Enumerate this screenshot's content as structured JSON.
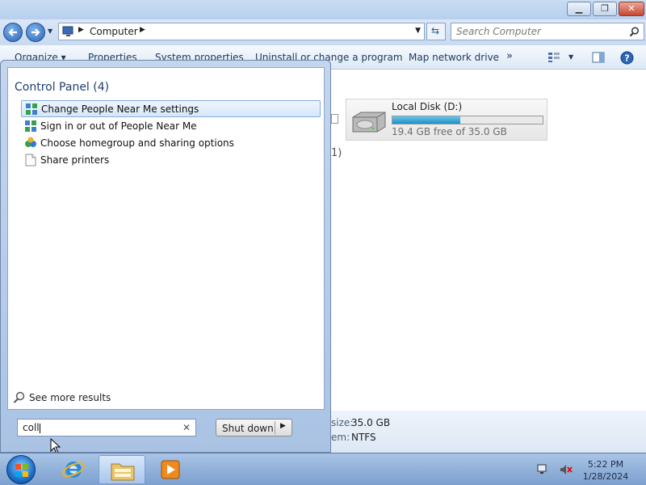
{
  "explorer": {
    "address_text": "Computer",
    "search_placeholder": "Search Computer",
    "toolbar": {
      "organize": "Organize ▾",
      "properties": "Properties",
      "system_properties": "System properties",
      "uninstall": "Uninstall or change a program",
      "map_drive": "Map network drive",
      "more": "»"
    },
    "disk": {
      "name": "Local Disk (D:)",
      "free_text": "19.4 GB free of 35.0 GB",
      "used_fraction": 0.45
    },
    "group_count_fragment": "1)",
    "details": {
      "size_label": "size:",
      "size_value": "35.0 GB",
      "fs_label": "em:",
      "fs_value": "NTFS"
    }
  },
  "start_menu": {
    "heading": "Control Panel (4)",
    "results": [
      {
        "label": "Change People Near Me settings",
        "icon": "people-near-me-icon"
      },
      {
        "label": "Sign in or out of People Near Me",
        "icon": "people-near-me-icon"
      },
      {
        "label": "Choose homegroup and sharing options",
        "icon": "homegroup-icon"
      },
      {
        "label": "Share printers",
        "icon": "blank-document-icon"
      }
    ],
    "see_more": "See more results",
    "search_value": "coll",
    "clear_glyph": "✕",
    "shutdown_label": "Shut down"
  },
  "taskbar": {
    "time": "5:22 PM",
    "date": "1/28/2024"
  },
  "colors": {
    "start_menu_bg": "#b4cae8",
    "selection": "#d5e7fa",
    "disk_fill": "#1b90c8"
  }
}
